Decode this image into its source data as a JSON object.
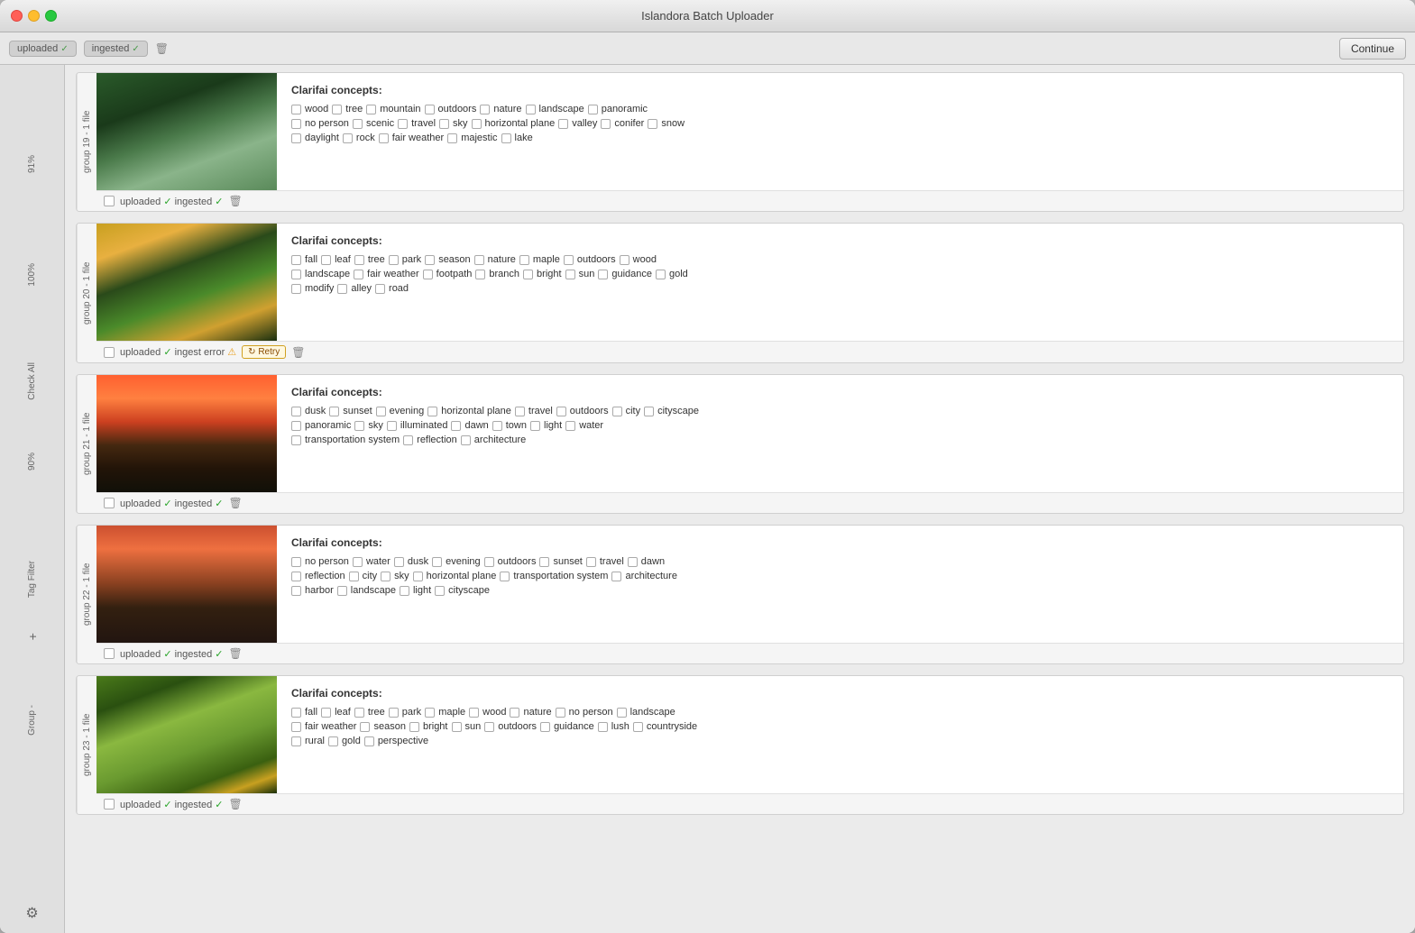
{
  "window": {
    "title": "Islandora Batch Uploader"
  },
  "toolbar": {
    "badges": [
      {
        "label": "uploaded",
        "checked": true
      },
      {
        "label": "ingested",
        "checked": true
      }
    ],
    "continue_btn": "Continue"
  },
  "sidebar": {
    "labels": [
      "91%",
      "100%",
      "Check All",
      "90%",
      "Tag Filter",
      "+",
      "Group -"
    ]
  },
  "groups": [
    {
      "id": "group-19",
      "label": "group 19 - 1 file",
      "thumbnail": "forest",
      "footer": {
        "uploaded": true,
        "ingested": true,
        "status": "uploaded ✓ ingested ✓"
      },
      "concepts_title": "Clarifai concepts:",
      "concept_rows": [
        [
          "wood",
          "tree",
          "mountain",
          "outdoors",
          "nature",
          "landscape",
          "panoramic"
        ],
        [
          "no person",
          "scenic",
          "travel",
          "sky",
          "horizontal plane",
          "valley",
          "conifer",
          "snow"
        ],
        [
          "daylight",
          "rock",
          "fair weather",
          "majestic",
          "lake"
        ]
      ]
    },
    {
      "id": "group-20",
      "label": "group 20 - 1 file",
      "thumbnail": "autumn",
      "footer": {
        "uploaded": true,
        "ingested": false,
        "ingest_error": true,
        "status": "uploaded ✓ ingest error ⚠"
      },
      "has_retry": true,
      "concepts_title": "Clarifai concepts:",
      "concept_rows": [
        [
          "fall",
          "leaf",
          "tree",
          "park",
          "season",
          "nature",
          "maple",
          "outdoors",
          "wood"
        ],
        [
          "landscape",
          "fair weather",
          "footpath",
          "branch",
          "bright",
          "sun",
          "guidance",
          "gold"
        ],
        [
          "modify",
          "alley",
          "road"
        ]
      ]
    },
    {
      "id": "group-21",
      "label": "group 21 - 1 file",
      "thumbnail": "sunset-city",
      "footer": {
        "uploaded": true,
        "ingested": true,
        "status": "uploaded ✓ ingested ✓"
      },
      "concepts_title": "Clarifai concepts:",
      "concept_rows": [
        [
          "dusk",
          "sunset",
          "evening",
          "horizontal plane",
          "travel",
          "outdoors",
          "city",
          "cityscape"
        ],
        [
          "panoramic",
          "sky",
          "illuminated",
          "dawn",
          "town",
          "light",
          "water"
        ],
        [
          "transportation system",
          "reflection",
          "architecture"
        ]
      ]
    },
    {
      "id": "group-22",
      "label": "group 22 - 1 file",
      "thumbnail": "harbor",
      "footer": {
        "uploaded": true,
        "ingested": true,
        "status": "uploaded ✓ ingested ✓"
      },
      "concepts_title": "Clarifai concepts:",
      "concept_rows": [
        [
          "no person",
          "water",
          "dusk",
          "evening",
          "outdoors",
          "sunset",
          "travel",
          "dawn"
        ],
        [
          "reflection",
          "city",
          "sky",
          "horizontal plane",
          "transportation system",
          "architecture"
        ],
        [
          "harbor",
          "landscape",
          "light",
          "cityscape"
        ]
      ]
    },
    {
      "id": "group-23",
      "label": "group 23 - 1 file",
      "thumbnail": "forest2",
      "footer": {
        "uploaded": true,
        "ingested": true,
        "status": "uploaded ✓ ingested ✓"
      },
      "concepts_title": "Clarifai concepts:",
      "concept_rows": [
        [
          "fall",
          "leaf",
          "tree",
          "park",
          "maple",
          "wood",
          "nature",
          "no person",
          "landscape"
        ],
        [
          "fair weather",
          "season",
          "bright",
          "sun",
          "outdoors",
          "guidance",
          "lush",
          "countryside"
        ],
        [
          "rural",
          "gold",
          "perspective"
        ]
      ]
    }
  ]
}
